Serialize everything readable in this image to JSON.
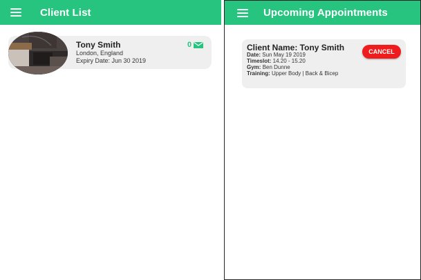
{
  "left": {
    "header": {
      "title": "Client List"
    },
    "client": {
      "name": "Tony Smith",
      "location": "London, England",
      "expiry": "Expiry Date: Jun 30 2019",
      "message_count": "0"
    }
  },
  "right": {
    "header": {
      "title": "Upcoming Appointments"
    },
    "appointment": {
      "title": "Client Name: Tony Smith",
      "date_label": "Date:",
      "date_value": "Sun May 19 2019",
      "timeslot_label": "Timeslot:",
      "timeslot_value": "14.20 - 15.20",
      "gym_label": "Gym:",
      "gym_value": "Ben Dunne",
      "training_label": "Training:",
      "training_value": "Upper Body | Back & Bicep",
      "cancel_label": "CANCEL"
    }
  },
  "colors": {
    "accent": "#27c47f",
    "cancel": "#ee1c1c",
    "card": "#efefef"
  },
  "icons": {
    "menu": "menu-icon",
    "mail": "mail-icon"
  }
}
